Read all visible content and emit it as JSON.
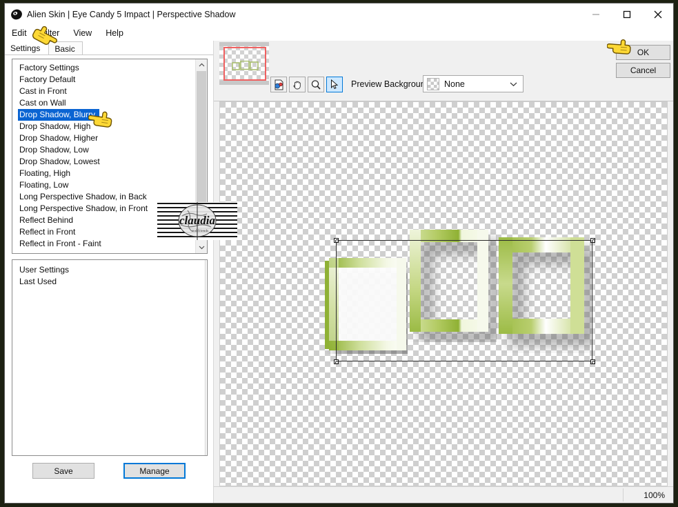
{
  "window": {
    "title": "Alien Skin | Eye Candy 5 Impact | Perspective Shadow",
    "app_icon": "alien-skin-icon",
    "minimize_label": "Minimize",
    "maximize_label": "Maximize",
    "close_label": "Close"
  },
  "menubar": {
    "items": [
      {
        "label": "Edit"
      },
      {
        "label": "Filter"
      },
      {
        "label": "View"
      },
      {
        "label": "Help"
      }
    ]
  },
  "tabs": [
    {
      "label": "Settings",
      "active": true
    },
    {
      "label": "Basic",
      "active": false
    }
  ],
  "settings_list": {
    "items": [
      {
        "label": "Factory Settings",
        "selected": false
      },
      {
        "label": "Factory Default",
        "selected": false
      },
      {
        "label": "Cast in Front",
        "selected": false
      },
      {
        "label": "Cast on Wall",
        "selected": false
      },
      {
        "label": "Drop Shadow, Blurry",
        "selected": true
      },
      {
        "label": "Drop Shadow, High",
        "selected": false
      },
      {
        "label": "Drop Shadow, Higher",
        "selected": false
      },
      {
        "label": "Drop Shadow, Low",
        "selected": false
      },
      {
        "label": "Drop Shadow, Lowest",
        "selected": false
      },
      {
        "label": "Floating, High",
        "selected": false
      },
      {
        "label": "Floating, Low",
        "selected": false
      },
      {
        "label": "Long Perspective Shadow, in Back",
        "selected": false
      },
      {
        "label": "Long Perspective Shadow, in Front",
        "selected": false
      },
      {
        "label": "Reflect Behind",
        "selected": false
      },
      {
        "label": "Reflect in Front",
        "selected": false
      },
      {
        "label": "Reflect in Front - Faint",
        "selected": false
      }
    ],
    "scroll_up_icon": "chevron-up-icon",
    "scroll_down_icon": "chevron-down-icon"
  },
  "user_settings_list": {
    "items": [
      {
        "label": "User Settings"
      },
      {
        "label": "Last Used"
      }
    ]
  },
  "buttons": {
    "save": "Save",
    "manage": "Manage",
    "ok": "OK",
    "cancel": "Cancel"
  },
  "toolbar": {
    "navigator_label": "navigator-thumbnail",
    "tools": [
      {
        "name": "compare-preview-tool",
        "active": false
      },
      {
        "name": "hand-tool",
        "active": false
      },
      {
        "name": "zoom-tool",
        "active": false
      },
      {
        "name": "arrow-select-tool",
        "active": true
      }
    ],
    "preview_background_label": "Preview Background:",
    "preview_background_value": "None"
  },
  "statusbar": {
    "zoom": "100%"
  },
  "watermark": {
    "text": "claudia"
  },
  "colors": {
    "selection_blue": "#0a64d2",
    "focus_blue": "#0078d7",
    "frame_green": "#9ab93f",
    "frame_pale": "#f2f7e2",
    "navigator_viewport": "#f06060",
    "cursor_yellow": "#ffd42a"
  },
  "canvas": {
    "frames": [
      {
        "name": "frame-left"
      },
      {
        "name": "frame-center"
      },
      {
        "name": "frame-right"
      }
    ],
    "selection": {
      "name": "selection-rectangle",
      "handles": 4
    }
  }
}
